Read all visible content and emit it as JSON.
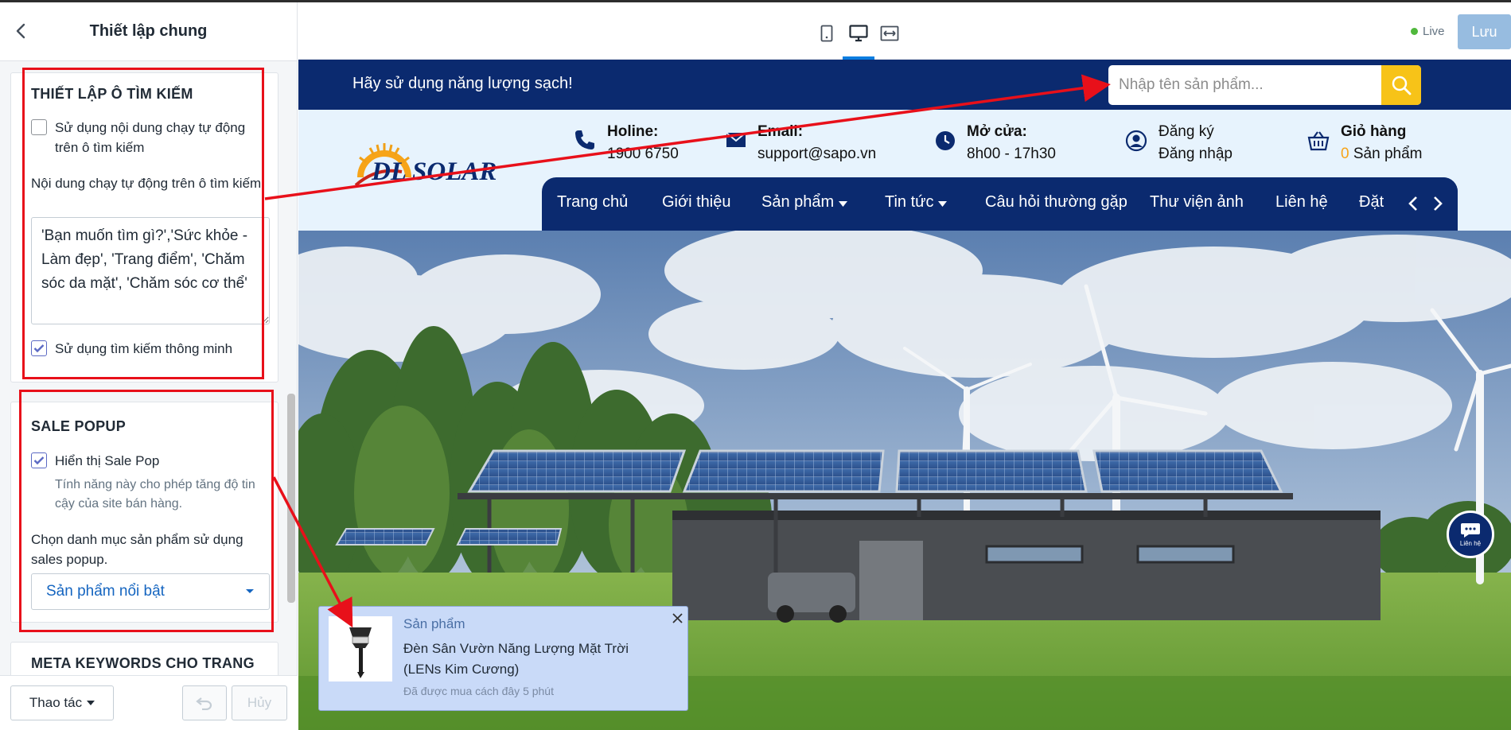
{
  "panel": {
    "title": "Thiết lập chung",
    "search_section": {
      "title": "THIẾT LẬP Ô TÌM KIẾM",
      "auto_text_checkbox": "Sử dụng nội dung chạy tự động trên ô tìm kiếm",
      "auto_text_label": "Nội dung chạy tự động trên ô tìm kiếm",
      "auto_text_value": "'Bạn muốn tìm gì?','Sức khỏe - Làm đẹp', 'Trang điểm', 'Chăm sóc da mặt', 'Chăm sóc cơ thể'",
      "smart_search_checkbox": "Sử dụng tìm kiếm thông minh"
    },
    "sale_section": {
      "title": "SALE POPUP",
      "show_checkbox": "Hiển thị Sale Pop",
      "show_hint": "Tính năng này cho phép tăng độ tin cậy của site bán hàng.",
      "category_label": "Chọn danh mục sản phẩm sử dụng sales popup.",
      "category_value": "Sản phẩm nổi bật"
    },
    "meta_section": {
      "title": "META KEYWORDS CHO TRANG"
    },
    "footer": {
      "actions_label": "Thao tác",
      "cancel_label": "Hủy"
    }
  },
  "toolbar": {
    "live_label": "Live",
    "save_label": "Lưu"
  },
  "site": {
    "promo": "Hãy sử dụng năng lượng sạch!",
    "search_placeholder": "Nhập tên sản phẩm...",
    "logo_text": "DL SOLAR",
    "hotline": {
      "label": "Holine:",
      "value": "1900 6750"
    },
    "email": {
      "label": "Email:",
      "value": "support@sapo.vn"
    },
    "open": {
      "label": "Mở cửa:",
      "value": "8h00 - 17h30"
    },
    "account": {
      "register": "Đăng ký",
      "login": "Đăng nhập"
    },
    "cart": {
      "label": "Giỏ hàng",
      "count": "0",
      "unit": "Sản phẩm"
    },
    "nav": [
      "Trang chủ",
      "Giới thiệu",
      "Sản phẩm",
      "Tin tức",
      "Câu hỏi thường gặp",
      "Thư viện ảnh",
      "Liên hệ",
      "Đặt"
    ],
    "contact_badge": "Liên hệ",
    "sale_popup": {
      "tag": "Sản phẩm",
      "product": "Đèn Sân Vườn Năng Lượng Mặt Trời (LENs Kim Cương)",
      "time": "Đã được mua cách đây 5 phút"
    }
  },
  "colors": {
    "navy": "#0b2a6f",
    "accent": "#f7c318",
    "annotation": "#e8101a",
    "checkbox": "#5c6ac4"
  }
}
